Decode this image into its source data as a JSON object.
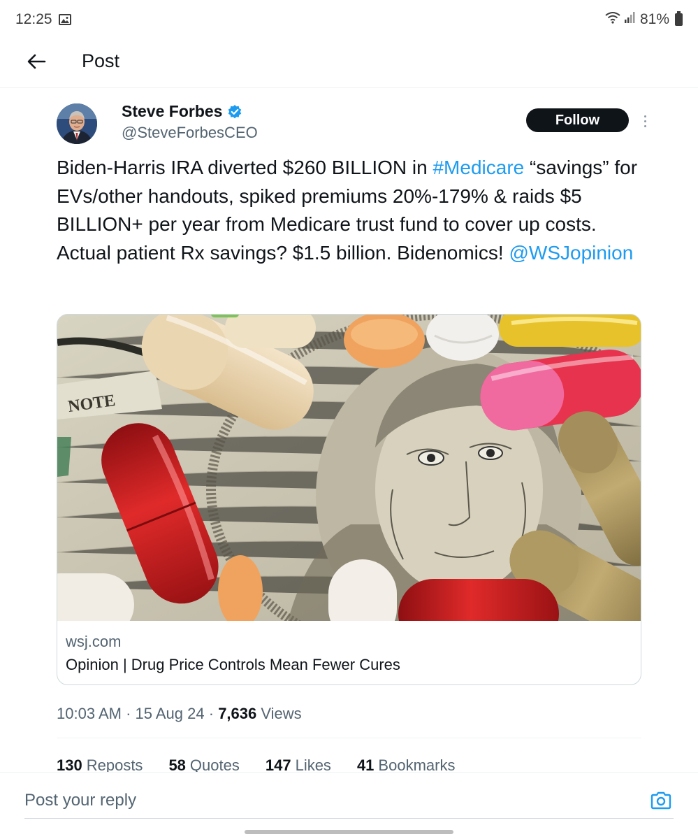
{
  "status_bar": {
    "time": "12:25",
    "battery": "81%",
    "image_icon": "image-icon",
    "wifi_icon": "wifi-icon",
    "signal_icon": "signal-icon"
  },
  "header": {
    "title": "Post",
    "back_icon": "back-arrow-icon"
  },
  "post": {
    "author": {
      "name": "Steve Forbes",
      "handle": "@SteveForbesCEO",
      "verified_icon": "verified-badge-icon"
    },
    "follow_label": "Follow",
    "more_icon": "more-options-icon",
    "text": {
      "part1": "Biden-Harris IRA diverted $260 BILLION in ",
      "hashtag": "#Medicare",
      "part2": " “savings” for EVs/other handouts, spiked premiums 20%-179% & raids $5 BILLION+ per year from Medicare trust fund to cover up costs. Actual patient Rx savings? $1.5 billion. Bidenomics! ",
      "mention": "@WSJopinion"
    },
    "card": {
      "domain": "wsj.com",
      "title": "Opinion | Drug Price Controls Mean Fewer Cures",
      "image_note_text": "NOTE"
    },
    "meta": {
      "time": "10:03 AM",
      "separator1": " · ",
      "date": "15 Aug 24",
      "separator2": " · ",
      "views_count": "7,636",
      "views_label": " Views"
    },
    "stats": [
      {
        "count": "130",
        "label": "Reposts"
      },
      {
        "count": "58",
        "label": "Quotes"
      },
      {
        "count": "147",
        "label": "Likes"
      },
      {
        "count": "41",
        "label": "Bookmarks"
      }
    ]
  },
  "reply": {
    "placeholder": "Post your reply",
    "camera_icon": "camera-icon"
  },
  "colors": {
    "accent": "#1d9bf0",
    "text": "#0f1419",
    "secondary": "#536471",
    "border": "#cfd9de"
  }
}
